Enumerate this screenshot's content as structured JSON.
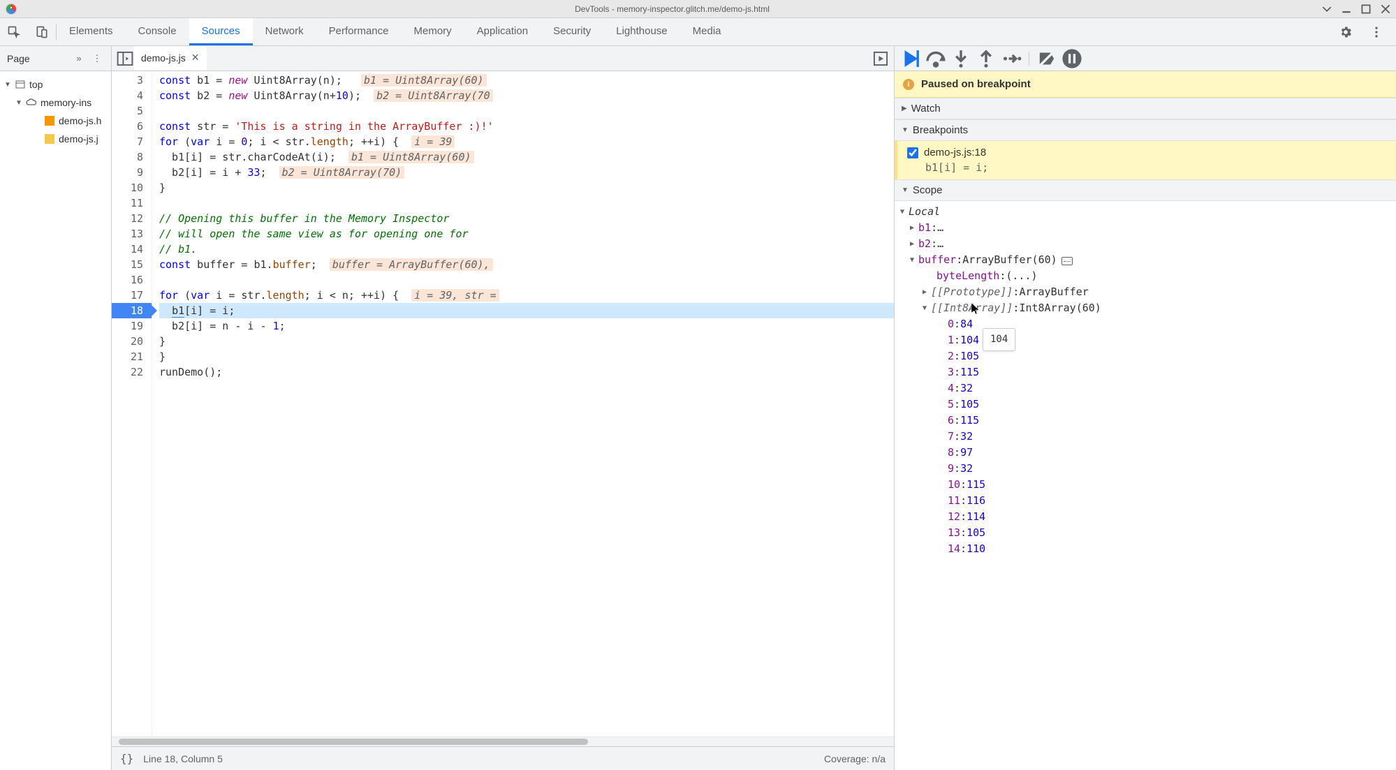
{
  "window": {
    "title": "DevTools - memory-inspector.glitch.me/demo-js.html"
  },
  "main_tabs": [
    "Elements",
    "Console",
    "Sources",
    "Network",
    "Performance",
    "Memory",
    "Application",
    "Security",
    "Lighthouse",
    "Media"
  ],
  "active_main_tab": "Sources",
  "page_nav": {
    "header": "Page",
    "tree": [
      {
        "label": "top",
        "icon": "frame",
        "indent": 0,
        "expanded": true
      },
      {
        "label": "memory-ins",
        "icon": "cloud",
        "indent": 1,
        "expanded": true
      },
      {
        "label": "demo-js.h",
        "icon": "html",
        "indent": 2
      },
      {
        "label": "demo-js.j",
        "icon": "js",
        "indent": 2,
        "selected": false
      }
    ]
  },
  "editor": {
    "tab_name": "demo-js.js",
    "status_line": "Line 18, Column 5",
    "status_coverage": "Coverage: n/a",
    "first_line": 3,
    "breakpoint_line": 18,
    "lines": [
      {
        "n": 3,
        "html": "<span class='kw'>const</span> b1 = <span class='kw2'>new</span> Uint8Array(n);   <span class='hint'>b1 = Uint8Array(60)</span>"
      },
      {
        "n": 4,
        "html": "<span class='kw'>const</span> b2 = <span class='kw2'>new</span> Uint8Array(n+<span class='num'>10</span>);  <span class='hint'>b2 = Uint8Array(70</span>"
      },
      {
        "n": 5,
        "html": ""
      },
      {
        "n": 6,
        "html": "<span class='kw'>const</span> str = <span class='str'>'This is a string in the ArrayBuffer :)!'</span>"
      },
      {
        "n": 7,
        "html": "<span class='kw'>for</span> (<span class='kw'>var</span> i = <span class='num'>0</span>; i &lt; str.<span class='prop'>length</span>; ++i) {  <span class='hint'>i = 39</span>"
      },
      {
        "n": 8,
        "html": "  b1[i] = str.charCodeAt(i);  <span class='hint'>b1 = Uint8Array(60)</span>"
      },
      {
        "n": 9,
        "html": "  b2[i] = i + <span class='num'>33</span>;  <span class='hint'>b2 = Uint8Array(70)</span>"
      },
      {
        "n": 10,
        "html": "}"
      },
      {
        "n": 11,
        "html": ""
      },
      {
        "n": 12,
        "html": "<span class='com'>// Opening this buffer in the Memory Inspector</span>"
      },
      {
        "n": 13,
        "html": "<span class='com'>// will open the same view as for opening one for</span>"
      },
      {
        "n": 14,
        "html": "<span class='com'>// b1.</span>"
      },
      {
        "n": 15,
        "html": "<span class='kw'>const</span> buffer = b1.<span class='prop'>buffer</span>;  <span class='hint'>buffer = ArrayBuffer(60),</span>"
      },
      {
        "n": 16,
        "html": ""
      },
      {
        "n": 17,
        "html": "<span class='kw'>for</span> (<span class='kw'>var</span> i = str.<span class='prop'>length</span>; i &lt; n; ++i) {  <span class='hint'>i = 39, str =</span>"
      },
      {
        "n": 18,
        "html": "  <span class='tok-under'>b1</span>[i] = i;",
        "exec": true
      },
      {
        "n": 19,
        "html": "  b2[i] = n - i - <span class='num'>1</span>;"
      },
      {
        "n": 20,
        "html": "}"
      },
      {
        "n": 21,
        "html": "}"
      },
      {
        "n": 22,
        "html": "runDemo();"
      }
    ]
  },
  "debugger": {
    "paused_text": "Paused on breakpoint",
    "sections": {
      "watch": "Watch",
      "breakpoints": "Breakpoints",
      "scope": "Scope"
    },
    "breakpoint": {
      "label": "demo-js.js:18",
      "code": "b1[i] = i;",
      "checked": true
    },
    "scope": {
      "group": "Local",
      "b1": "…",
      "b2": "…",
      "buffer": {
        "type": "ArrayBuffer(60)",
        "byteLength": "(...)",
        "prototype": "ArrayBuffer",
        "int8": {
          "type": "Int8Array(60)",
          "values": [
            {
              "i": 0,
              "v": 84
            },
            {
              "i": 1,
              "v": 104
            },
            {
              "i": 2,
              "v": 105
            },
            {
              "i": 3,
              "v": 115
            },
            {
              "i": 4,
              "v": 32
            },
            {
              "i": 5,
              "v": 105
            },
            {
              "i": 6,
              "v": 115
            },
            {
              "i": 7,
              "v": 32
            },
            {
              "i": 8,
              "v": 97
            },
            {
              "i": 9,
              "v": 32
            },
            {
              "i": 10,
              "v": 115
            },
            {
              "i": 11,
              "v": 116
            },
            {
              "i": 12,
              "v": 114
            },
            {
              "i": 13,
              "v": 105
            },
            {
              "i": 14,
              "v": 110
            }
          ]
        }
      }
    },
    "tooltip_value": "104"
  }
}
